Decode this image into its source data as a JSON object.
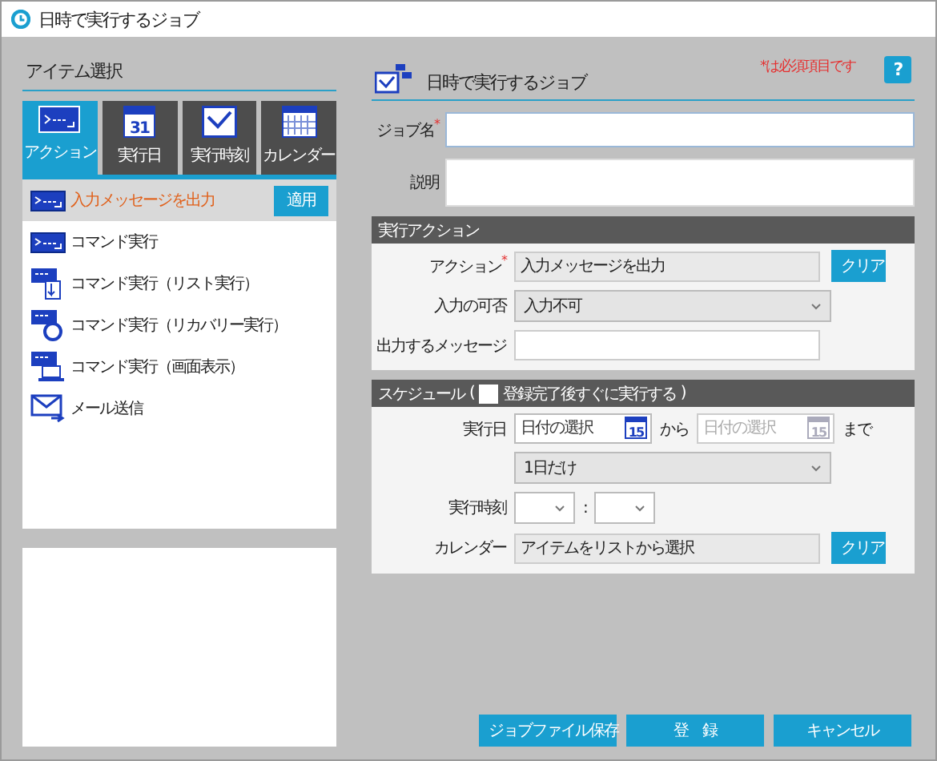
{
  "window": {
    "title": "日時で実行するジョブ"
  },
  "item_panel": {
    "title": "アイテム選択",
    "apply_button": "適用",
    "tabs": [
      {
        "kind": "action",
        "label": "アクション",
        "selected": true
      },
      {
        "kind": "date",
        "label": "実行日",
        "day": "31",
        "selected": false
      },
      {
        "kind": "time",
        "label": "実行時刻",
        "selected": false
      },
      {
        "kind": "calendar",
        "label": "カレンダー",
        "selected": false
      }
    ],
    "items": [
      {
        "kind": "command",
        "label": "入力メッセージを出力",
        "selected": true
      },
      {
        "kind": "command",
        "label": "コマンド実行",
        "selected": false
      },
      {
        "kind": "list",
        "label": "コマンド実行（リスト実行）",
        "selected": false
      },
      {
        "kind": "recovery",
        "label": "コマンド実行（リカバリー実行）",
        "selected": false
      },
      {
        "kind": "screen",
        "label": "コマンド実行（画面表示）",
        "selected": false
      },
      {
        "kind": "mail",
        "label": "メール送信",
        "selected": false
      }
    ]
  },
  "form": {
    "title": "日時で実行するジョブ",
    "required_note": "*は必須項目です",
    "help": "?",
    "job_name": {
      "label": "ジョブ名$^{*}$"
    },
    "description": {
      "label": "説明"
    }
  },
  "action_section": {
    "title": "実行アクション",
    "fields": [
      {
        "kind": "text",
        "label": "アクション$^{*}$",
        "value": "入力メッセージを出力",
        "readonly": true,
        "button": "クリア"
      },
      {
        "kind": "select",
        "label": "入力の可否",
        "value": "入力不可"
      },
      {
        "kind": "text",
        "label": "出力するメッセージ",
        "readonly": false
      }
    ]
  },
  "schedule_section": {
    "title": "スケジュール",
    "paren_open": "(",
    "paren_close": ")",
    "checkbox": {
      "label": "登録完了後すぐに実行する",
      "checked": false
    },
    "date_row": {
      "label": "実行日",
      "from": {
        "placeholder": "日付の選択",
        "day": "15",
        "disabled": false
      },
      "between": "から",
      "to": {
        "placeholder": "日付の選択",
        "day": "15",
        "disabled": true
      },
      "after": "まで"
    },
    "repeat": {
      "value": "1日だけ"
    },
    "time": {
      "label": "実行時刻",
      "separator": ":"
    },
    "calendar": {
      "label": "カレンダー",
      "value": "アイテムをリストから選択",
      "button": "クリア"
    }
  },
  "buttons": [
    "ジョブファイル保存",
    "登　録",
    "キャンセル"
  ]
}
